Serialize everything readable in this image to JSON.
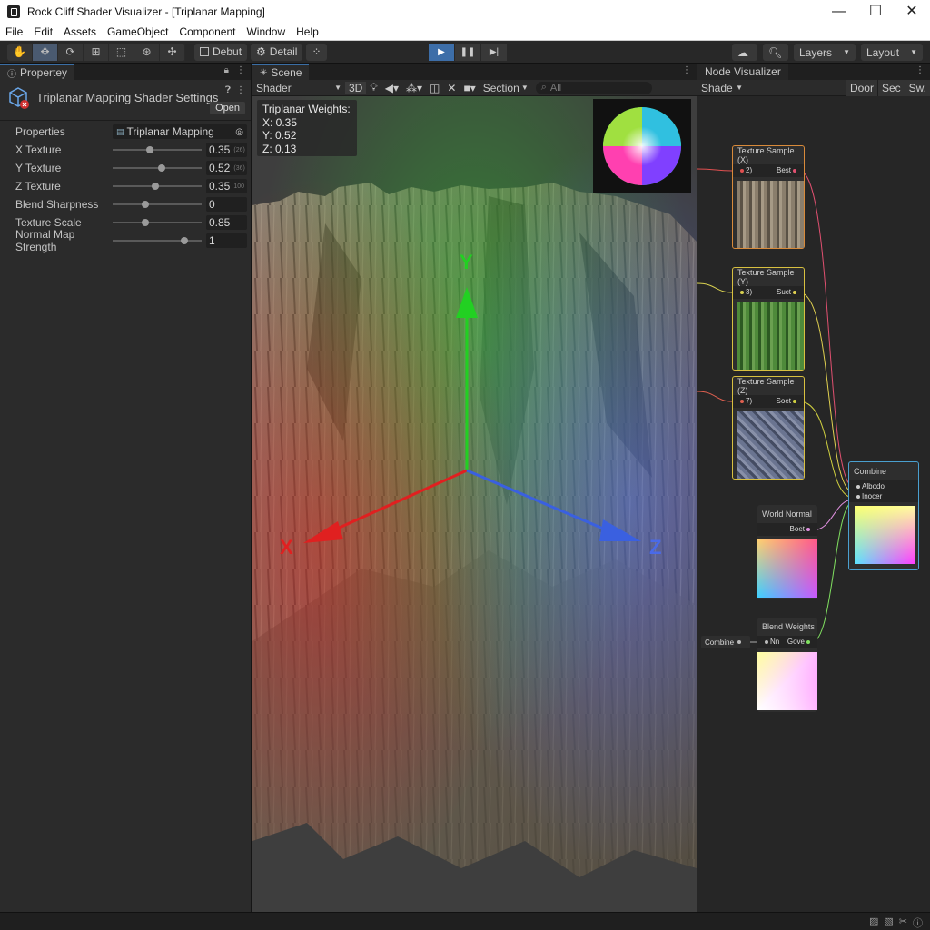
{
  "window": {
    "title": "Rock Cliff Shader Visualizer - [Triplanar Mapping]",
    "controls": [
      "—",
      "☐",
      "✕"
    ]
  },
  "menu": [
    "File",
    "Edit",
    "Assets",
    "GameObject",
    "Component",
    "Window",
    "Help"
  ],
  "toolbar": {
    "debug_label": "Debut",
    "detail_label": "Detail",
    "layers_label": "Layers",
    "layout_label": "Layout"
  },
  "properties_panel": {
    "tab_label": "Propertey",
    "title": "Triplanar Mapping Shader Settings",
    "open_label": "Open",
    "properties_label": "Properties",
    "shader_value": "Triplanar Mapping",
    "rows": [
      {
        "label": "X Texture",
        "value": "0.35",
        "hint": "(26)",
        "level": 0.42
      },
      {
        "label": "Y Texture",
        "value": "0.52",
        "hint": "(36)",
        "level": 0.55
      },
      {
        "label": "Z Texture",
        "value": "0.35",
        "hint": "100",
        "level": 0.48
      },
      {
        "label": "Blend Sharpness",
        "value": "0",
        "hint": "",
        "level": 0.37
      },
      {
        "label": "Texture Scale",
        "value": "0.85",
        "hint": "",
        "level": 0.37
      },
      {
        "label": "Normal Map Strength",
        "value": "1",
        "hint": "",
        "level": 0.81
      }
    ]
  },
  "scene_panel": {
    "tab_label": "Scene",
    "shader_dropdown": "Shader",
    "mode_3d": "3D",
    "section_label": "Section",
    "search_placeholder": "All",
    "weights": {
      "title": "Triplanar Weights:",
      "x": "X: 0.35",
      "y": "Y: 0.52",
      "z": "Z: 0.13"
    },
    "axes": {
      "x": "X",
      "y": "Y",
      "z": "Z"
    },
    "colors": {
      "x": "#e02020",
      "y": "#22c022",
      "z": "#3a60e0"
    }
  },
  "node_panel": {
    "tab_label": "Node Visualizer",
    "shade_dropdown": "Shade",
    "buttons": [
      "Door",
      "Sec",
      "Sw."
    ],
    "nodes": {
      "tex_x": {
        "title": "Texture Sample (X)",
        "in": "2)",
        "out": "Best"
      },
      "tex_y": {
        "title": "Texture Sample (Y)",
        "in": "3)",
        "out": "Suct"
      },
      "tex_z": {
        "title": "Texture Sample (Z)",
        "in": "7)",
        "out": "Soet"
      },
      "world_normal": {
        "title": "World Normal",
        "out": "Boet"
      },
      "blend_weights": {
        "title": "Blend Weights",
        "in": "Nn",
        "out": "Gove"
      },
      "combine": {
        "title": "Combine",
        "in1": "Albodo",
        "in2": "Inocer"
      },
      "combine_tag": "Combine"
    }
  }
}
